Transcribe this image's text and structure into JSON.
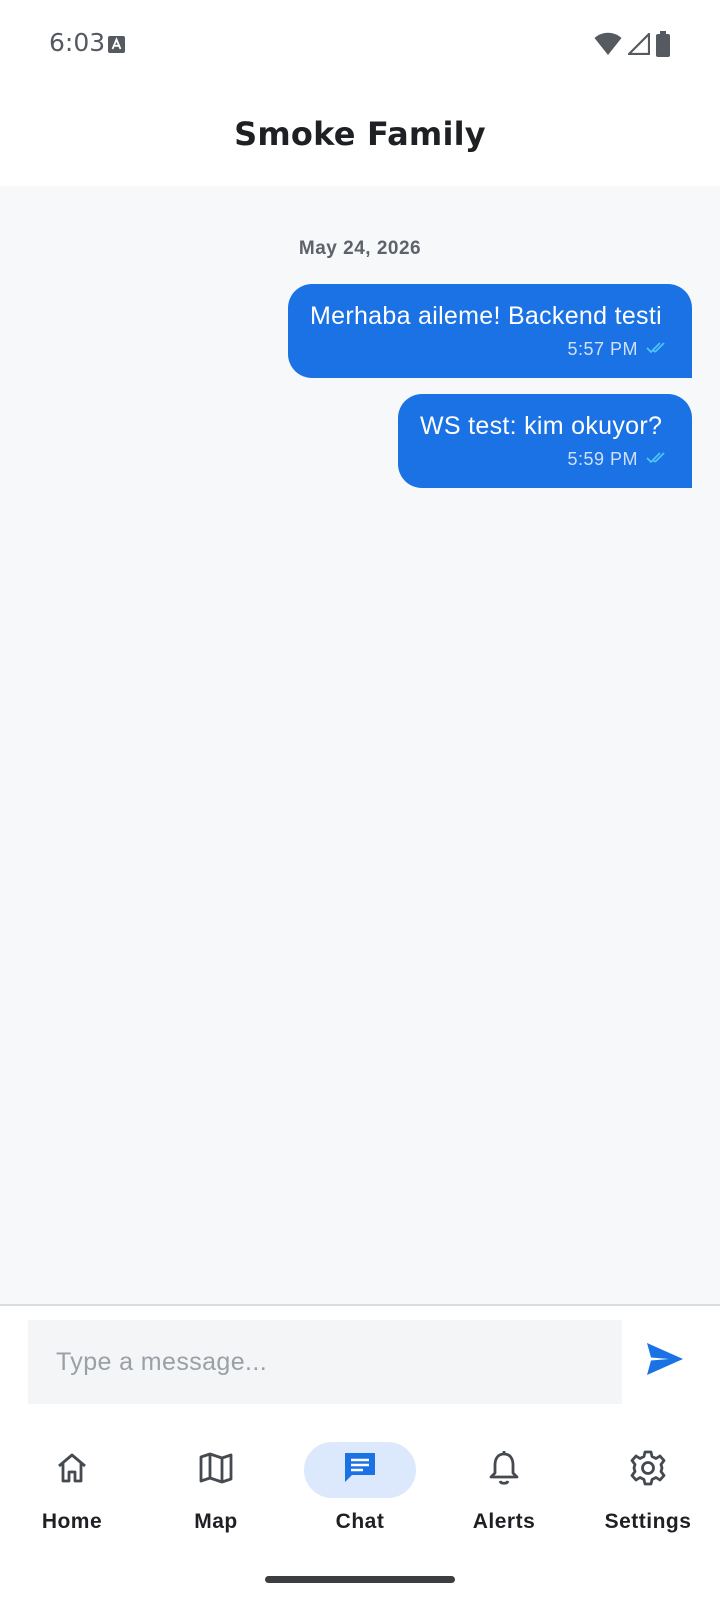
{
  "status_bar": {
    "time": "6:03",
    "icons": [
      "keyboard-a-icon",
      "wifi-icon",
      "signal-icon",
      "battery-icon"
    ]
  },
  "header": {
    "title": "Smoke Family"
  },
  "chat": {
    "date_separator": "May 24, 2026",
    "messages": [
      {
        "text": "Merhaba aileme! Backend testi",
        "time": "5:57 PM",
        "status": "read",
        "direction": "outgoing"
      },
      {
        "text": "WS test: kim okuyor?",
        "time": "5:59 PM",
        "status": "read",
        "direction": "outgoing"
      }
    ]
  },
  "composer": {
    "value": "",
    "placeholder": "Type a message...",
    "send_icon": "send-icon"
  },
  "nav": {
    "active": "Chat",
    "items": [
      {
        "label": "Home",
        "icon": "home-icon"
      },
      {
        "label": "Map",
        "icon": "map-icon"
      },
      {
        "label": "Chat",
        "icon": "chat-icon"
      },
      {
        "label": "Alerts",
        "icon": "bell-icon"
      },
      {
        "label": "Settings",
        "icon": "gear-icon"
      }
    ]
  },
  "colors": {
    "accent": "#1b72e4",
    "chat_background": "#f6f8fa",
    "active_nav_pill": "#dce9fc",
    "read_ticks": "#4fc3f7"
  }
}
